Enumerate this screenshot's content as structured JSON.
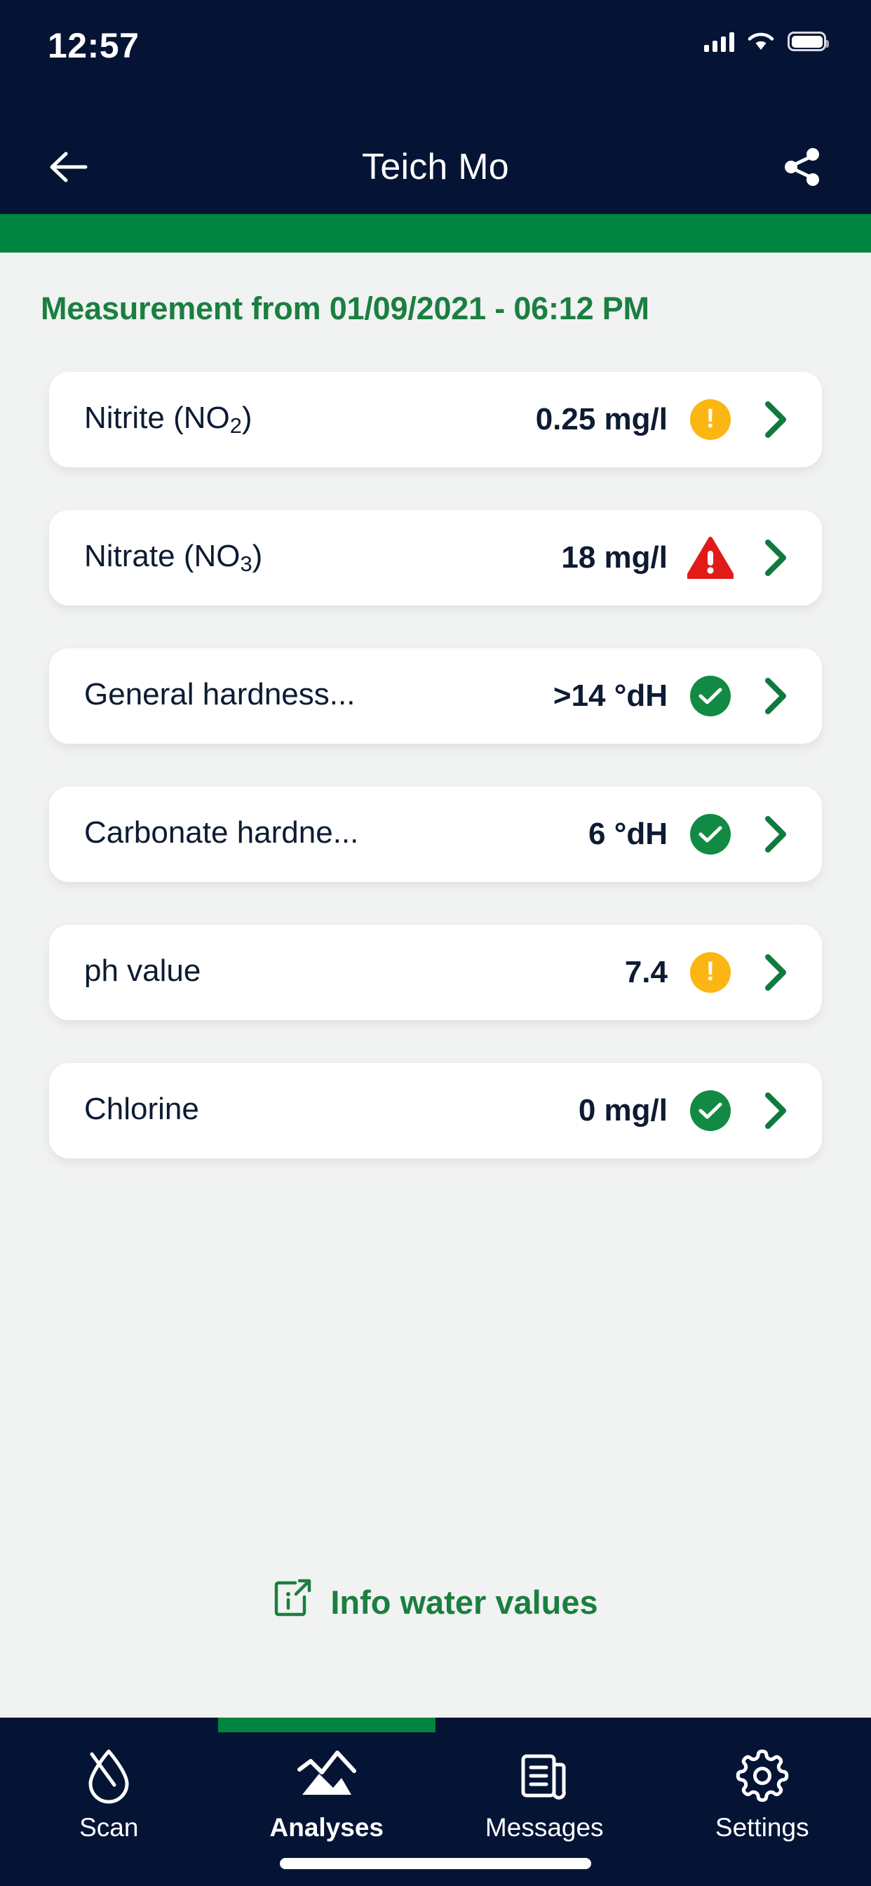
{
  "status_bar": {
    "time": "12:57",
    "signal_icon": "cellular-signal-icon",
    "wifi_icon": "wifi-icon",
    "battery_icon": "battery-icon"
  },
  "navbar": {
    "back_icon": "arrow-left-icon",
    "title": "Teich Mo",
    "share_icon": "share-icon"
  },
  "measurement": {
    "header": "Measurement from 01/09/2021 - 06:12 PM",
    "accent_color": "#1a7f40"
  },
  "colors": {
    "header_bg": "#051435",
    "accent_green": "#008540",
    "page_bg": "#f1f2f2",
    "status_ok": "#138a43",
    "status_warn": "#fcb614",
    "status_alert": "#e11b18",
    "card_bg": "#ffffff",
    "text_dark": "#0d1b33"
  },
  "rows": [
    {
      "label_prefix": "Nitrite (NO",
      "label_sub": "2",
      "label_suffix": ")",
      "label": "Nitrite (NO2)",
      "value": "0.25 mg/l",
      "status": "warn",
      "status_icon": "warning-circle-icon",
      "chevron_icon": "chevron-right-icon"
    },
    {
      "label_prefix": "Nitrate (NO",
      "label_sub": "3",
      "label_suffix": ")",
      "label": "Nitrate (NO3)",
      "value": "18 mg/l",
      "status": "alert",
      "status_icon": "alert-triangle-icon",
      "chevron_icon": "chevron-right-icon"
    },
    {
      "label_prefix": "General hardness...",
      "label_sub": "",
      "label_suffix": "",
      "label": "General hardness...",
      "value": ">14 °dH",
      "status": "ok",
      "status_icon": "check-circle-icon",
      "chevron_icon": "chevron-right-icon"
    },
    {
      "label_prefix": "Carbonate hardne...",
      "label_sub": "",
      "label_suffix": "",
      "label": "Carbonate hardne...",
      "value": "6 °dH",
      "status": "ok",
      "status_icon": "check-circle-icon",
      "chevron_icon": "chevron-right-icon"
    },
    {
      "label_prefix": "ph value",
      "label_sub": "",
      "label_suffix": "",
      "label": "ph value",
      "value": "7.4",
      "status": "warn",
      "status_icon": "warning-circle-icon",
      "chevron_icon": "chevron-right-icon"
    },
    {
      "label_prefix": "Chlorine",
      "label_sub": "",
      "label_suffix": "",
      "label": "Chlorine",
      "value": "0 mg/l",
      "status": "ok",
      "status_icon": "check-circle-icon",
      "chevron_icon": "chevron-right-icon"
    }
  ],
  "info_link": {
    "label": "Info water values",
    "icon": "info-external-link-icon"
  },
  "tabbar": {
    "items": [
      {
        "label": "Scan",
        "icon": "water-drop-scan-icon",
        "active": false
      },
      {
        "label": "Analyses",
        "icon": "chart-mountain-icon",
        "active": true
      },
      {
        "label": "Messages",
        "icon": "news-document-icon",
        "active": false
      },
      {
        "label": "Settings",
        "icon": "gear-icon",
        "active": false
      }
    ]
  }
}
